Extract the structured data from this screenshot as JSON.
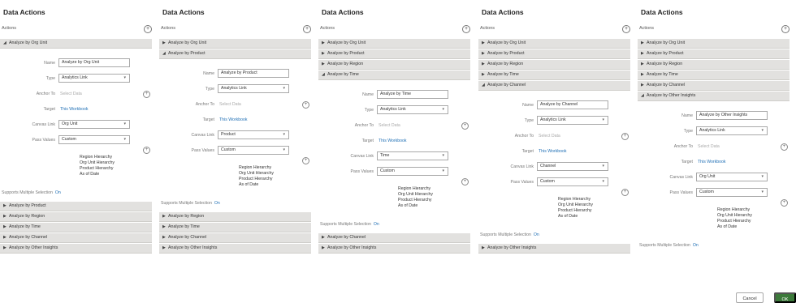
{
  "panels": [
    {
      "title": "Data Actions",
      "actions_label": "Actions",
      "top_bars": [
        {
          "label": "Analyze by Org Unit",
          "chev": "◢"
        }
      ],
      "form": {
        "name_label": "Name",
        "name_value": "Analyze by Org Unit",
        "type_label": "Type",
        "type_value": "Analytics Link",
        "anchor_label": "Anchor To",
        "anchor_placeholder": "Select Data",
        "target_label": "Target",
        "target_value": "This Workbook",
        "canvas_label": "Canvas Link",
        "canvas_value": "Org Unit",
        "pass_label": "Pass Values",
        "pass_value": "Custom"
      },
      "values": [
        "Region Hierarchy",
        "Org Unit Hierarchy",
        "Product Hierarchy",
        "As of Date"
      ],
      "sms_label": "Supports Multiple Selection",
      "sms_value": "On",
      "bottom_bars": [
        {
          "label": "Analyze by Product",
          "chev": "▶"
        },
        {
          "label": "Analyze by Region",
          "chev": "▶"
        },
        {
          "label": "Analyze by Time",
          "chev": "▶"
        },
        {
          "label": "Analyze by Channel",
          "chev": "▶"
        },
        {
          "label": "Analyze by Other Insights",
          "chev": "▶"
        }
      ]
    },
    {
      "title": "Data Actions",
      "actions_label": "Actions",
      "top_bars": [
        {
          "label": "Analyze by Org Unit",
          "chev": "▶"
        },
        {
          "label": "Analyze by Product",
          "chev": "◢"
        }
      ],
      "form": {
        "name_label": "Name",
        "name_value": "Analyze by Product",
        "type_label": "Type",
        "type_value": "Analytics Link",
        "anchor_label": "Anchor To",
        "anchor_placeholder": "Select Data",
        "target_label": "Target",
        "target_value": "This Workbook",
        "canvas_label": "Canvas Link",
        "canvas_value": "Product",
        "pass_label": "Pass Values",
        "pass_value": "Custom"
      },
      "values": [
        "Region Hierarchy",
        "Org Unit Hierarchy",
        "Product Hierarchy",
        "As of Date"
      ],
      "sms_label": "Supports Multiple Selection",
      "sms_value": "On",
      "bottom_bars": [
        {
          "label": "Analyze by Region",
          "chev": "▶"
        },
        {
          "label": "Analyze by Time",
          "chev": "▶"
        },
        {
          "label": "Analyze by Channel",
          "chev": "▶"
        },
        {
          "label": "Analyze by Other Insights",
          "chev": "▶"
        }
      ]
    },
    {
      "title": "Data Actions",
      "actions_label": "Actions",
      "top_bars": [
        {
          "label": "Analyze by Org Unit",
          "chev": "▶"
        },
        {
          "label": "Analyze by Product",
          "chev": "▶"
        },
        {
          "label": "Analyze by Region",
          "chev": "▶"
        },
        {
          "label": "Analyze by Time",
          "chev": "◢"
        }
      ],
      "form": {
        "name_label": "Name",
        "name_value": "Analyze by Time",
        "type_label": "Type",
        "type_value": "Analytics Link",
        "anchor_label": "Anchor To",
        "anchor_placeholder": "Select Data",
        "target_label": "Target",
        "target_value": "This Workbook",
        "canvas_label": "Canvas Link",
        "canvas_value": "Time",
        "pass_label": "Pass Values",
        "pass_value": "Custom"
      },
      "values": [
        "Region Hierarchy",
        "Org Unit Hierarchy",
        "Product Hierarchy",
        "As of Date"
      ],
      "sms_label": "Supports Multiple Selection",
      "sms_value": "On",
      "bottom_bars": [
        {
          "label": "Analyze by Channel",
          "chev": "▶"
        },
        {
          "label": "Analyze by Other Insights",
          "chev": "▶"
        }
      ]
    },
    {
      "title": "Data Actions",
      "actions_label": "Actions",
      "top_bars": [
        {
          "label": "Analyze by Org Unit",
          "chev": "▶"
        },
        {
          "label": "Analyze by Product",
          "chev": "▶"
        },
        {
          "label": "Analyze by Region",
          "chev": "▶"
        },
        {
          "label": "Analyze by Time",
          "chev": "▶"
        },
        {
          "label": "Analyze by Channel",
          "chev": "◢"
        }
      ],
      "form": {
        "name_label": "Name",
        "name_value": "Analyze by Channel",
        "type_label": "Type",
        "type_value": "Analytics Link",
        "anchor_label": "Anchor To",
        "anchor_placeholder": "Select Data",
        "target_label": "Target",
        "target_value": "This Workbook",
        "canvas_label": "Canvas Link",
        "canvas_value": "Channel",
        "pass_label": "Pass Values",
        "pass_value": "Custom"
      },
      "values": [
        "Region Hierarchy",
        "Org Unit Hierarchy",
        "Product Hierarchy",
        "As of Date"
      ],
      "sms_label": "Supports Multiple Selection",
      "sms_value": "On",
      "bottom_bars": [
        {
          "label": "Analyze by Other Insights",
          "chev": "▶"
        }
      ]
    },
    {
      "title": "Data Actions",
      "actions_label": "Actions",
      "top_bars": [
        {
          "label": "Analyze by Org Unit",
          "chev": "▶"
        },
        {
          "label": "Analyze by Product",
          "chev": "▶"
        },
        {
          "label": "Analyze by Region",
          "chev": "▶"
        },
        {
          "label": "Analyze by Time",
          "chev": "▶"
        },
        {
          "label": "Analyze by Channel",
          "chev": "▶"
        },
        {
          "label": "Analyze by Other Insights",
          "chev": "◢"
        }
      ],
      "form": {
        "name_label": "Name",
        "name_value": "Analyze by Other Insights",
        "type_label": "Type",
        "type_value": "Analytics Link",
        "anchor_label": "Anchor To",
        "anchor_placeholder": "Select Data",
        "target_label": "Target",
        "target_value": "This Workbook",
        "canvas_label": "Canvas Link",
        "canvas_value": "Org Unit",
        "pass_label": "Pass Values",
        "pass_value": "Custom"
      },
      "values": [
        "Region Hierarchy",
        "Org Unit Hierarchy",
        "Product Hierarchy",
        "As of Date"
      ],
      "sms_label": "Supports Multiple Selection",
      "sms_value": "On",
      "bottom_bars": []
    }
  ],
  "footer": {
    "cancel_label": "Cancel",
    "ok_label": "OK"
  }
}
